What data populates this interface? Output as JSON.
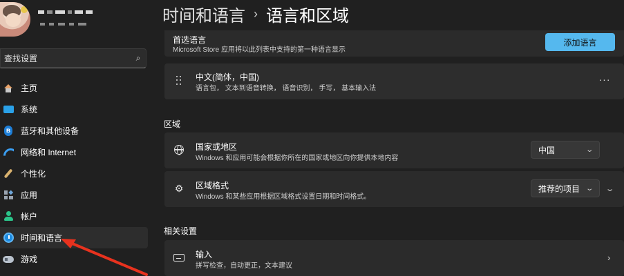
{
  "user": {
    "name": "",
    "email": ""
  },
  "search": {
    "placeholder": "查找设置"
  },
  "nav": {
    "items": [
      {
        "label": "主页",
        "icon": "home-icon"
      },
      {
        "label": "系统",
        "icon": "system-icon"
      },
      {
        "label": "蓝牙和其他设备",
        "icon": "bluetooth-icon"
      },
      {
        "label": "网络和 Internet",
        "icon": "wifi-icon"
      },
      {
        "label": "个性化",
        "icon": "brush-icon"
      },
      {
        "label": "应用",
        "icon": "apps-icon"
      },
      {
        "label": "帐户",
        "icon": "account-icon"
      },
      {
        "label": "时间和语言",
        "icon": "time-language-icon",
        "active": true
      },
      {
        "label": "游戏",
        "icon": "gaming-icon"
      }
    ]
  },
  "breadcrumb": {
    "parent": "时间和语言",
    "separator": "›",
    "current": "语言和区域"
  },
  "preferred_language": {
    "title": "首选语言",
    "description": "Microsoft Store 应用将以此列表中支持的第一种语言显示",
    "add_button": "添加语言"
  },
  "language_item": {
    "title": "中文(简体，中国)",
    "description": "语言包， 文本到语音转换， 语音识别， 手写， 基本输入法",
    "more": "···"
  },
  "region": {
    "section_title": "区域",
    "country": {
      "title": "国家或地区",
      "description": "Windows 和应用可能会根据你所在的国家或地区向你提供本地内容",
      "value": "中国"
    },
    "format": {
      "title": "区域格式",
      "description": "Windows 和某些应用根据区域格式设置日期和时间格式。",
      "value": "推荐的项目"
    }
  },
  "related": {
    "section_title": "相关设置",
    "typing": {
      "title": "输入",
      "description": "拼写检查，自动更正，文本建议"
    }
  },
  "colors": {
    "accent": "#55b8ee",
    "background": "#202020",
    "card": "#2b2b2b",
    "annotation_arrow": "#e8321e"
  }
}
